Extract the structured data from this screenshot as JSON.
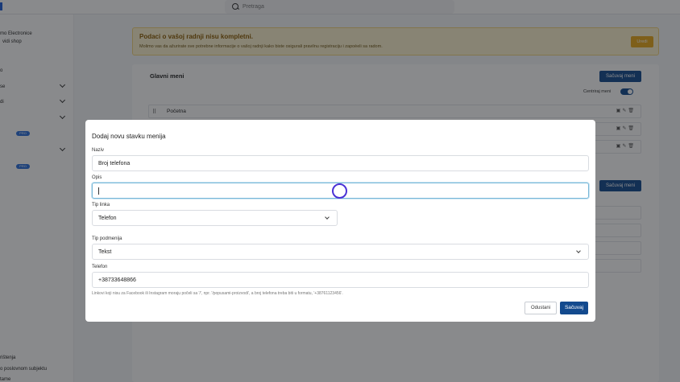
{
  "topbar": {
    "search_placeholder": "Pretraga"
  },
  "sidebar": {
    "company_name": "mo Electronice",
    "view_shop": "vidi shop",
    "items": [
      "o",
      "se",
      "di"
    ],
    "badge": "PRO",
    "footer": [
      "rištenja",
      "o poslovnom subjektu",
      "tame"
    ]
  },
  "warning": {
    "title": "Podaci o vašoj radnji nisu kompletni.",
    "text": "Molimo vas da ažurirate sve potrebne informacije o vašoj radnji kako biste osigurali pravilnu registraciju i zapoèeli sa radom.",
    "button": "Uredi"
  },
  "menu": {
    "title": "Glavni meni",
    "save_label": "Sačuvaj meni",
    "center_label": "Centriraj meni",
    "first_item": "Početna"
  },
  "modal": {
    "title": "Dodaj novu stavku menija",
    "name_label": "Naziv",
    "name_value": "Broj telefona",
    "desc_label": "Opis",
    "desc_value": "",
    "link_type_label": "Tip linka",
    "link_type_value": "Telefon",
    "submenu_type_label": "Tip podmenija",
    "submenu_type_value": "Tekst",
    "phone_label": "Telefon",
    "phone_value": "+38733648866",
    "hint": "Linkovi koji nisu za Facebook ili Instagram moraju počeli sa '/', npr. '/popusami-proizvodi', a broj telefona treba biti u formatu, '+38761123456'.",
    "cancel_label": "Odustani",
    "save_label": "Sačuvaj"
  }
}
